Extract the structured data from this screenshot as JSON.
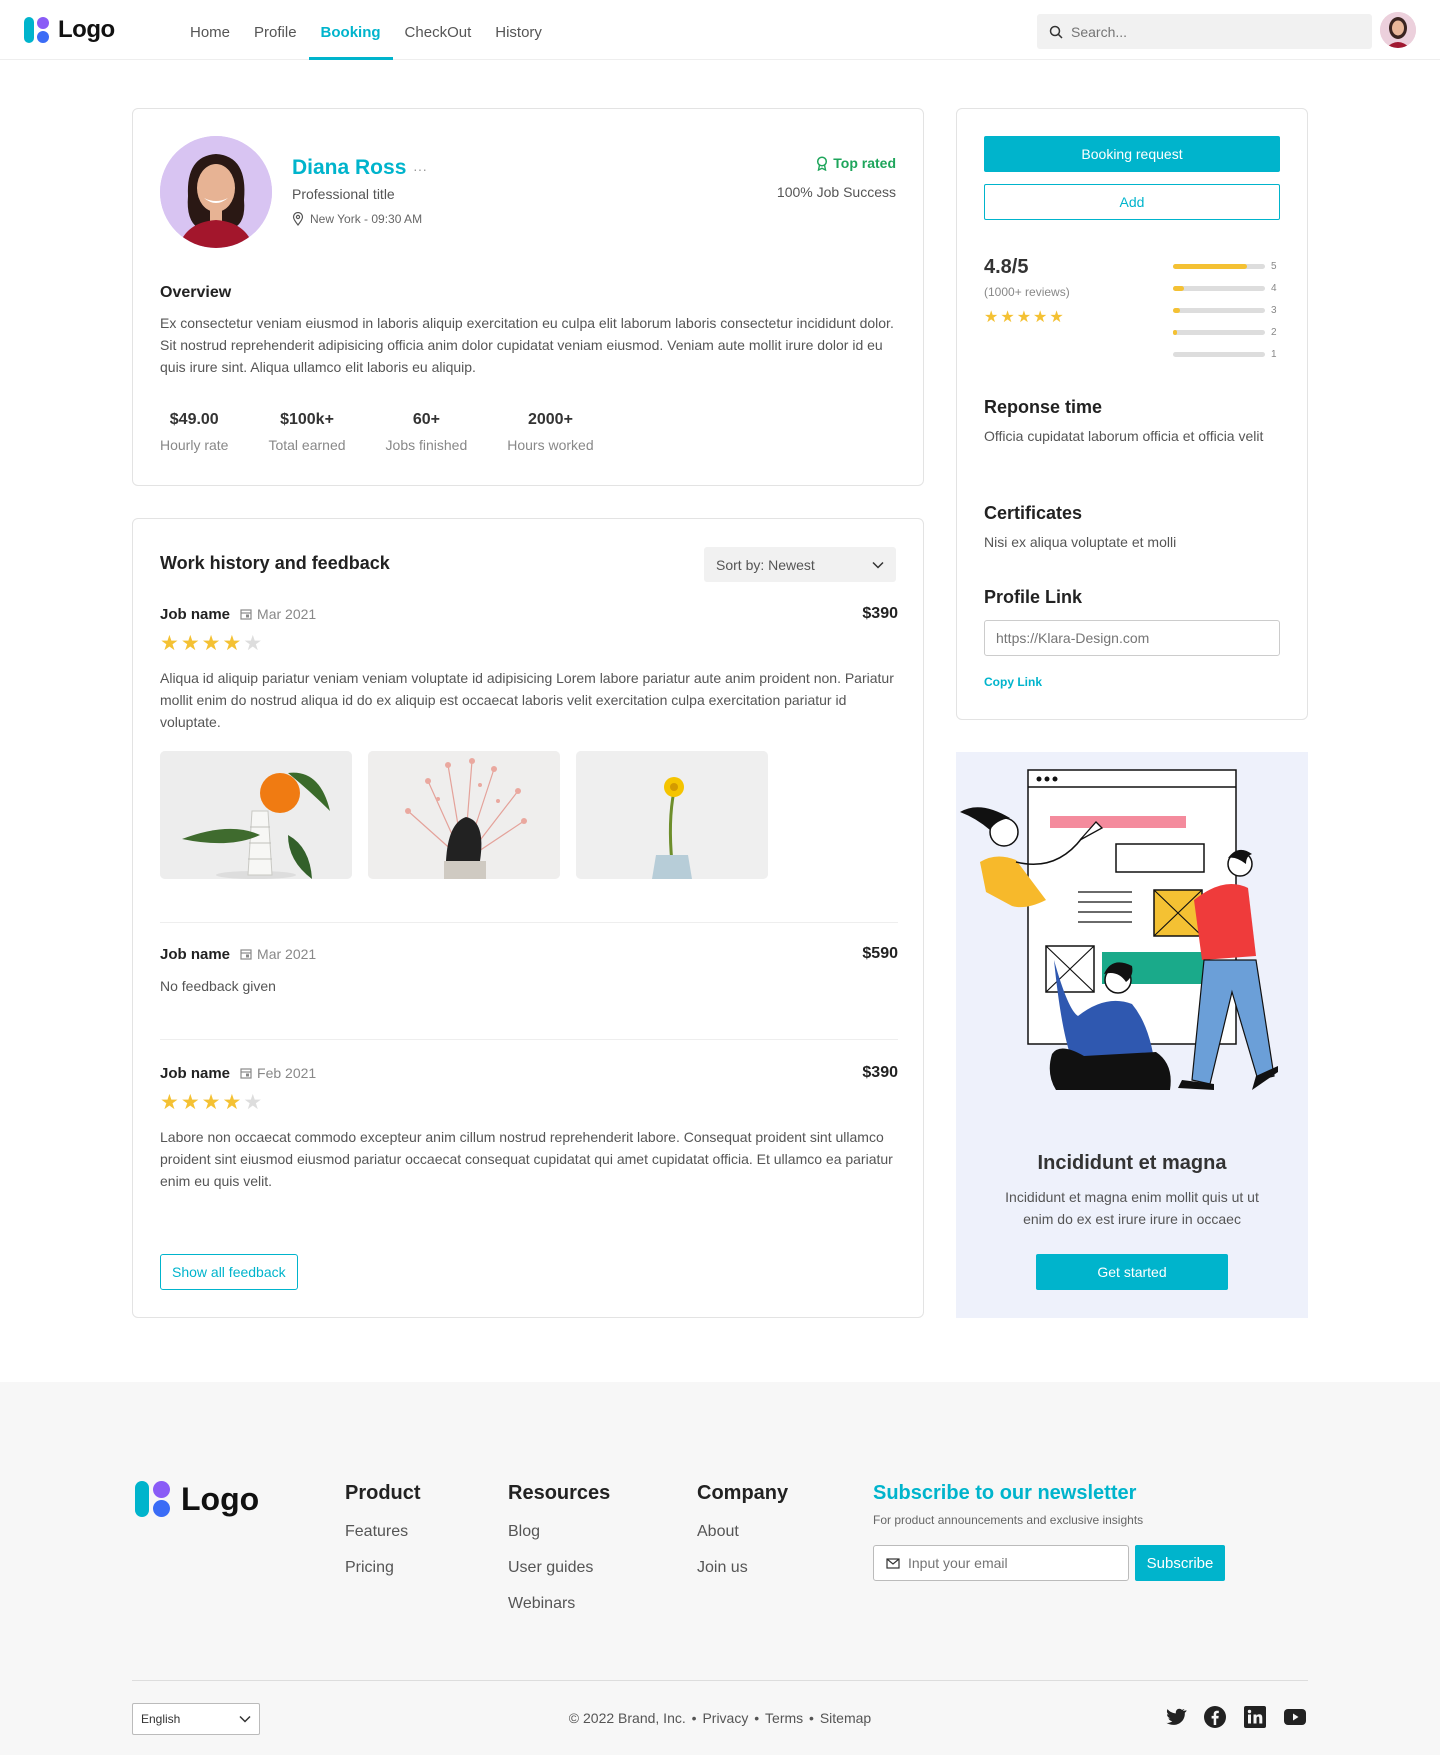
{
  "nav": {
    "logo_text": "Logo",
    "links": [
      "Home",
      "Profile",
      "Booking",
      "CheckOut",
      "History"
    ],
    "active": "Booking",
    "search_placeholder": "Search..."
  },
  "profile": {
    "name": "Diana Ross",
    "more": "···",
    "title": "Professional title",
    "location": "New York - 09:30 AM",
    "badge": "Top rated",
    "success": "100% Job Success",
    "overview_heading": "Overview",
    "overview_text": "Ex consectetur veniam eiusmod in laboris aliquip exercitation eu culpa elit laborum laboris consectetur incididunt dolor. Sit nostrud reprehenderit adipisicing officia anim dolor cupidatat veniam eiusmod. Veniam aute mollit irure dolor id eu quis irure sint. Aliqua ullamco elit laboris eu aliquip.",
    "stats": [
      {
        "value": "$49.00",
        "label": "Hourly rate"
      },
      {
        "value": "$100k+",
        "label": "Total earned"
      },
      {
        "value": "60+",
        "label": "Jobs finished"
      },
      {
        "value": "2000+",
        "label": "Hours worked"
      }
    ]
  },
  "work": {
    "heading": "Work history and feedback",
    "sort_label": "Sort by: Newest",
    "jobs": [
      {
        "name": "Job name",
        "date": "Mar 2021",
        "price": "$390",
        "rating": 4,
        "text": "Aliqua id aliquip pariatur veniam veniam voluptate id adipisicing Lorem labore pariatur aute anim proident non. Pariatur mollit enim do nostrud aliqua id do ex aliquip est occaecat laboris velit exercitation culpa exercitation pariatur id voluptate."
      },
      {
        "name": "Job name",
        "date": "Mar 2021",
        "price": "$590",
        "text": "No feedback given"
      },
      {
        "name": "Job name",
        "date": "Feb 2021",
        "price": "$390",
        "rating": 4,
        "text": "Labore non occaecat commodo excepteur anim cillum nostrud reprehenderit labore. Consequat proident sint ullamco proident sint eiusmod eiusmod pariatur occaecat consequat cupidatat qui amet cupidatat officia. Et ullamco ea pariatur enim eu quis velit."
      }
    ],
    "show_all": "Show all feedback"
  },
  "side": {
    "booking_btn": "Booking request",
    "add_btn": "Add",
    "rating": "4.8/5",
    "review_count": "(1000+ reviews)",
    "rating_stars": 4.5,
    "distribution": [
      {
        "star": "5",
        "fraction": 0.8
      },
      {
        "star": "4",
        "fraction": 0.12
      },
      {
        "star": "3",
        "fraction": 0.08
      },
      {
        "star": "2",
        "fraction": 0.04
      },
      {
        "star": "1",
        "fraction": 0.0
      }
    ],
    "response_heading": "Reponse time",
    "response_text": "Officia cupidatat laborum officia et officia velit",
    "cert_heading": "Certificates",
    "cert_text": "Nisi ex aliqua voluptate et molli",
    "link_heading": "Profile Link",
    "link_value": "https://Klara-Design.com",
    "copy_label": "Copy Link"
  },
  "promo": {
    "title": "Incididunt et magna",
    "text": "Incididunt et magna enim mollit quis ut ut enim do ex est irure irure in occaec",
    "button": "Get started"
  },
  "footer": {
    "logo_text": "Logo",
    "product": {
      "heading": "Product",
      "items": [
        "Features",
        "Pricing"
      ]
    },
    "resources": {
      "heading": "Resources",
      "items": [
        "Blog",
        "User guides",
        "Webinars"
      ]
    },
    "company": {
      "heading": "Company",
      "items": [
        "About",
        "Join us"
      ]
    },
    "newsletter": {
      "heading": "Subscribe to our newsletter",
      "sub": "For product announcements and exclusive insights",
      "placeholder": "Input your email",
      "button": "Subscribe"
    },
    "language": "English",
    "copyright": "© 2022 Brand, Inc.",
    "links": [
      "Privacy",
      "Terms",
      "Sitemap"
    ],
    "social": [
      "twitter-icon",
      "facebook-icon",
      "linkedin-icon",
      "youtube-icon"
    ]
  },
  "colors": {
    "accent": "#00b4cc",
    "star": "#f4c133",
    "success": "#1ea55b"
  }
}
